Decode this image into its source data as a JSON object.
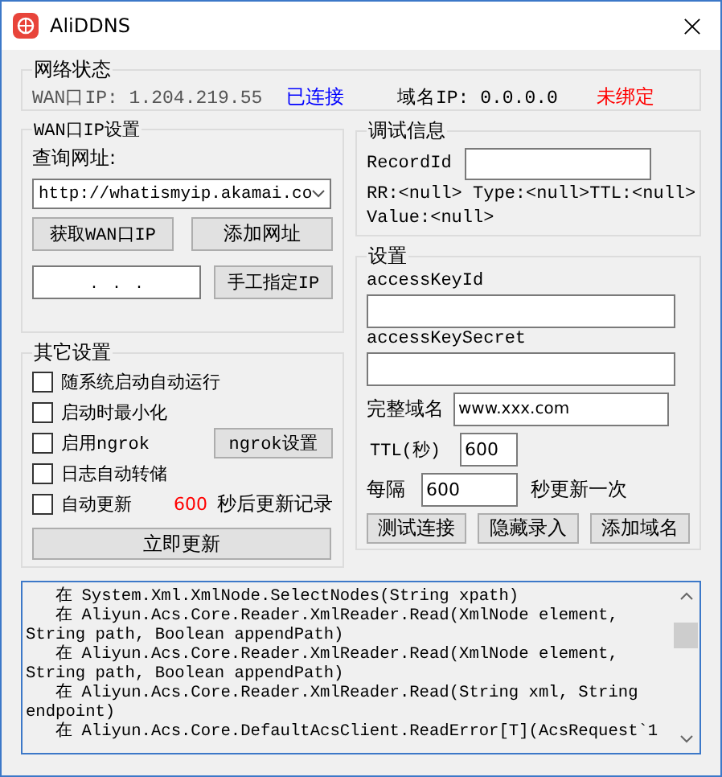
{
  "window": {
    "title": "AliDDNS"
  },
  "network_status": {
    "title": "网络状态",
    "wan_ip": "WAN口IP: 1.204.219.55",
    "connection": "已连接",
    "domain_ip": "域名IP: 0.0.0.0",
    "binding": "未绑定"
  },
  "wan_settings": {
    "title": "WAN口IP设置",
    "query_label": "查询网址:",
    "query_url": "http://whatismyip.akamai.co",
    "buttons": [
      "获取WAN口IP",
      "添加网址"
    ],
    "ip_value": ".   .   .",
    "set_button": "手工指定IP"
  },
  "debug": {
    "title": "调试信息",
    "record_label": "RecordId",
    "info_lines": [
      "RR:<null> Type:<null>TTL:<null>",
      "Value:<null>"
    ]
  },
  "other_settings": {
    "title": "其它设置",
    "options": [
      {
        "label": "随系统启动自动运行",
        "checked": false
      },
      {
        "label": "启动时最小化",
        "checked": false
      },
      {
        "label": "启用ngrok",
        "checked": false
      },
      {
        "label": "日志自动转储",
        "checked": false
      },
      {
        "label": "自动更新",
        "checked": false
      }
    ],
    "ngrok_button": "ngrok设置",
    "countdown": "600",
    "countdown_suffix": "秒后更新记录",
    "update_button": "立即更新"
  },
  "settings": {
    "title": "设置",
    "access_key_id_label": "accessKeyId",
    "access_key_secret_label": "accessKeySecret",
    "domain_label": "完整域名",
    "domain": "www.xxx.com",
    "ttl_label": "TTL(秒)",
    "ttl": "600",
    "interval_label": "每隔",
    "interval": "600",
    "interval_suffix": "秒更新一次",
    "buttons": [
      "测试连接",
      "隐藏录入",
      "添加域名"
    ]
  },
  "log": {
    "lines": [
      "   在 System.Xml.XmlNode.SelectNodes(String xpath)",
      "   在 Aliyun.Acs.Core.Reader.XmlReader.Read(XmlNode element,",
      "String path, Boolean appendPath)",
      "   在 Aliyun.Acs.Core.Reader.XmlReader.Read(XmlNode element,",
      "String path, Boolean appendPath)",
      "   在 Aliyun.Acs.Core.Reader.XmlReader.Read(String xml, String",
      "endpoint)",
      "   在 Aliyun.Acs.Core.DefaultAcsClient.ReadError[T](AcsRequest`1"
    ]
  }
}
